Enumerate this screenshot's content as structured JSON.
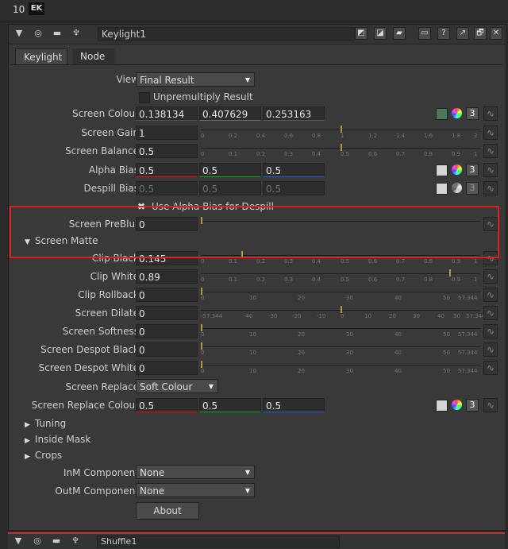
{
  "topbar": {
    "number": "10",
    "tag": "EK"
  },
  "titlebar": {
    "collapse_icon": "▼",
    "node_name": "Keylight1",
    "icons": [
      "◎",
      "▬",
      "♆",
      "◩",
      "◪",
      "▰",
      "▭",
      "?",
      "↗",
      "🗗",
      "✕"
    ]
  },
  "tabs": {
    "keylight": "Keylight",
    "node": "Node"
  },
  "view": {
    "label": "View",
    "value": "Final Result"
  },
  "unpremultiply": {
    "label": "Unpremultiply Result"
  },
  "screen_colour": {
    "label": "Screen Colour",
    "r": "0.138134",
    "g": "0.407629",
    "b": "0.253163",
    "badge": "3"
  },
  "screen_gain": {
    "label": "Screen Gain",
    "value": "1",
    "ticks": [
      "0",
      "0.2",
      "0.4",
      "0.6",
      "0.8",
      "1",
      "1.2",
      "1.4",
      "1.6",
      "1.8",
      "2"
    ]
  },
  "screen_balance": {
    "label": "Screen Balance",
    "value": "0.5",
    "ticks": [
      "0",
      "0.1",
      "0.2",
      "0.3",
      "0.4",
      "0.5",
      "0.6",
      "0.7",
      "0.8",
      "0.9",
      "1"
    ]
  },
  "alpha_bias": {
    "label": "Alpha Bias",
    "r": "0.5",
    "g": "0.5",
    "b": "0.5",
    "badge": "3"
  },
  "despill_bias": {
    "label": "Despill Bias",
    "r": "0.5",
    "g": "0.5",
    "b": "0.5",
    "badge": "3"
  },
  "use_alpha_bias": {
    "label": "Use Alpha Bias for Despill",
    "mark": "✖"
  },
  "screen_preblur": {
    "label": "Screen PreBlur",
    "value": "0"
  },
  "screen_matte": {
    "label": "Screen Matte",
    "marker": "▼"
  },
  "clip_black": {
    "label": "Clip Black",
    "value": "0.145",
    "ticks": [
      "0",
      "0.1",
      "0.2",
      "0.3",
      "0.4",
      "0.5",
      "0.6",
      "0.7",
      "0.8",
      "0.9",
      "1"
    ]
  },
  "clip_white": {
    "label": "Clip White",
    "value": "0.89",
    "ticks": [
      "0",
      "0.1",
      "0.2",
      "0.3",
      "0.4",
      "0.5",
      "0.6",
      "0.7",
      "0.8",
      "0.9",
      "1"
    ]
  },
  "clip_rollback": {
    "label": "Clip Rollback",
    "value": "0",
    "ticks": [
      "0",
      "10",
      "20",
      "30",
      "40",
      "50",
      "57.344"
    ]
  },
  "screen_dilate": {
    "label": "Screen Dilate",
    "value": "0",
    "ticks": [
      "-57.344",
      "-40",
      "-30",
      "-20",
      "-10",
      "0",
      "10",
      "20",
      "30",
      "40",
      "50",
      "57.344"
    ]
  },
  "screen_softness": {
    "label": "Screen Softness",
    "value": "0",
    "ticks": [
      "0",
      "10",
      "20",
      "30",
      "40",
      "50",
      "57.344"
    ]
  },
  "despot_black": {
    "label": "Screen Despot Black",
    "value": "0",
    "ticks": [
      "0",
      "10",
      "20",
      "30",
      "40",
      "50",
      "57.344"
    ]
  },
  "despot_white": {
    "label": "Screen Despot White",
    "value": "0",
    "ticks": [
      "0",
      "10",
      "20",
      "30",
      "40",
      "50",
      "57.344"
    ]
  },
  "screen_replace": {
    "label": "Screen Replace",
    "value": "Soft Colour"
  },
  "screen_replace_colour": {
    "label": "Screen Replace Colour",
    "r": "0.5",
    "g": "0.5",
    "b": "0.5",
    "badge": "3"
  },
  "sections": {
    "tuning": "Tuning",
    "inside_mask": "Inside Mask",
    "crops": "Crops",
    "marker": "▶"
  },
  "inm": {
    "label": "InM Component",
    "value": "None"
  },
  "outm": {
    "label": "OutM Component",
    "value": "None"
  },
  "about": {
    "label": "About"
  },
  "bottom_node": {
    "name": "Shuffle1"
  }
}
